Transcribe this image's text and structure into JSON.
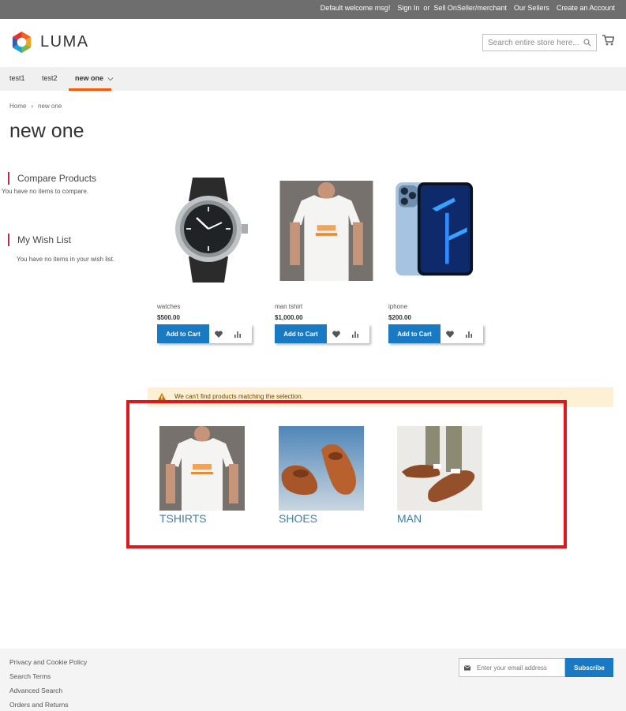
{
  "topbar": {
    "welcome": "Default welcome msg!",
    "sign_in": "Sign In",
    "or": "or",
    "sell": "Sell OnSeller/merchant",
    "our_sellers": "Our Sellers",
    "create_account": "Create an Account"
  },
  "header": {
    "logo_text": "LUMA",
    "search_placeholder": "Search entire store here..."
  },
  "nav": {
    "items": [
      {
        "label": "test1"
      },
      {
        "label": "test2"
      },
      {
        "label": "new one"
      }
    ]
  },
  "breadcrumb": {
    "home": "Home",
    "separator": "›",
    "current": "new one"
  },
  "page_title": "new one",
  "sidebar": {
    "compare_title": "Compare Products",
    "compare_note": "You have no items to compare.",
    "wishlist_title": "My Wish List",
    "wishlist_note": "You have no items in your wish list."
  },
  "products": [
    {
      "name": "watches",
      "price": "$500.00",
      "add_to_cart": "Add to Cart"
    },
    {
      "name": "man tshirt",
      "price": "$1,000.00",
      "add_to_cart": "Add to Cart"
    },
    {
      "name": "iphone",
      "price": "$200.00",
      "add_to_cart": "Add to Cart"
    }
  ],
  "notice": {
    "text": "We can't find products matching the selection."
  },
  "categories": [
    {
      "label": "TSHIRTS"
    },
    {
      "label": "SHOES"
    },
    {
      "label": "MAN"
    }
  ],
  "footer": {
    "links": [
      "Privacy and Cookie Policy",
      "Search Terms",
      "Advanced Search",
      "Orders and Returns"
    ],
    "email_placeholder": "Enter your email address",
    "subscribe": "Subscribe"
  },
  "colors": {
    "topbar": "#6e6e6e",
    "primary_button": "#1979c3",
    "nav_active": "#ff5501",
    "highlight_border": "#e3151a",
    "category_label": "#3e7da7",
    "notice_bg": "#fdf0d5"
  },
  "icons": {
    "search": "search-icon",
    "cart": "cart-icon",
    "wishlist": "heart-icon",
    "compare": "compare-icon",
    "warning": "warning-icon",
    "email": "envelope-icon",
    "dropdown": "chevron-down-icon"
  }
}
